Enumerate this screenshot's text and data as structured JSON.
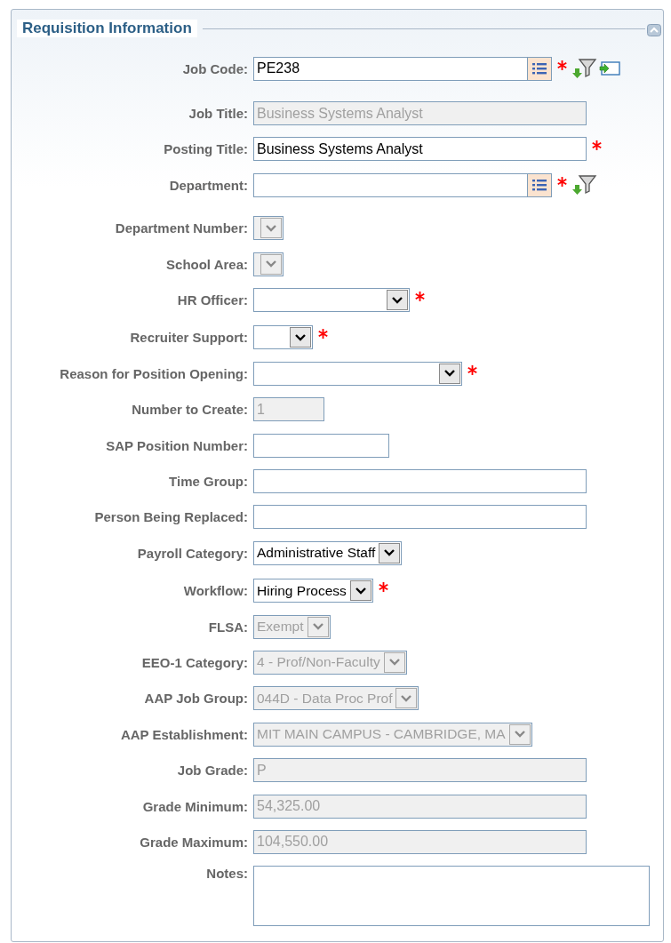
{
  "panel": {
    "title": "Requisition Information"
  },
  "fields": [
    {
      "label": "Job Code:",
      "kind": "lookup",
      "value": "PE238",
      "disabled": false,
      "required": true,
      "filter": true,
      "go": true
    },
    {
      "label": "Job Title:",
      "kind": "text",
      "value": "Business Systems Analyst",
      "disabled": true,
      "required": false
    },
    {
      "label": "Posting Title:",
      "kind": "text",
      "value": "Business Systems Analyst",
      "disabled": false,
      "required": true
    },
    {
      "label": "Department:",
      "kind": "lookup",
      "disabled": false,
      "required": true,
      "filter": true,
      "go": false
    },
    {
      "label": "Department Number:",
      "kind": "select",
      "disabled": true,
      "required": false
    },
    {
      "label": "School Area:",
      "kind": "select",
      "disabled": true,
      "required": false
    },
    {
      "label": "HR Officer:",
      "kind": "select",
      "disabled": false,
      "required": true
    },
    {
      "label": "Recruiter Support:",
      "kind": "select",
      "disabled": false,
      "required": true
    },
    {
      "label": "Reason for Position Opening:",
      "kind": "select",
      "disabled": false,
      "required": true
    },
    {
      "label": "Number to Create:",
      "kind": "text",
      "value": "1",
      "disabled": true,
      "required": false
    },
    {
      "label": "SAP Position Number:",
      "kind": "text",
      "disabled": false,
      "required": false
    },
    {
      "label": "Time Group:",
      "kind": "text",
      "disabled": false,
      "required": false
    },
    {
      "label": "Person Being Replaced:",
      "kind": "text",
      "disabled": false,
      "required": false
    },
    {
      "label": "Payroll Category:",
      "kind": "select",
      "value": "Administrative Staff",
      "disabled": false,
      "required": false
    },
    {
      "label": "Workflow:",
      "kind": "select",
      "value": "Hiring Process",
      "disabled": false,
      "required": true
    },
    {
      "label": "FLSA:",
      "kind": "select",
      "value": "Exempt",
      "disabled": true,
      "required": false
    },
    {
      "label": "EEO-1 Category:",
      "kind": "select",
      "value": "4 - Prof/Non-Faculty",
      "disabled": true,
      "required": false
    },
    {
      "label": "AAP Job Group:",
      "kind": "select",
      "value": "044D - Data Proc Prof",
      "disabled": true,
      "required": false
    },
    {
      "label": "AAP Establishment:",
      "kind": "select",
      "value": "MIT MAIN CAMPUS - CAMBRIDGE, MA",
      "disabled": true,
      "required": false
    },
    {
      "label": "Job Grade:",
      "kind": "text",
      "value": "P",
      "disabled": true,
      "required": false
    },
    {
      "label": "Grade Minimum:",
      "kind": "text",
      "value": "54,325.00",
      "disabled": true,
      "required": false
    },
    {
      "label": "Grade Maximum:",
      "kind": "text",
      "value": "104,550.00",
      "disabled": true,
      "required": false
    },
    {
      "label": "Notes:",
      "kind": "textarea",
      "disabled": false,
      "required": false
    }
  ]
}
